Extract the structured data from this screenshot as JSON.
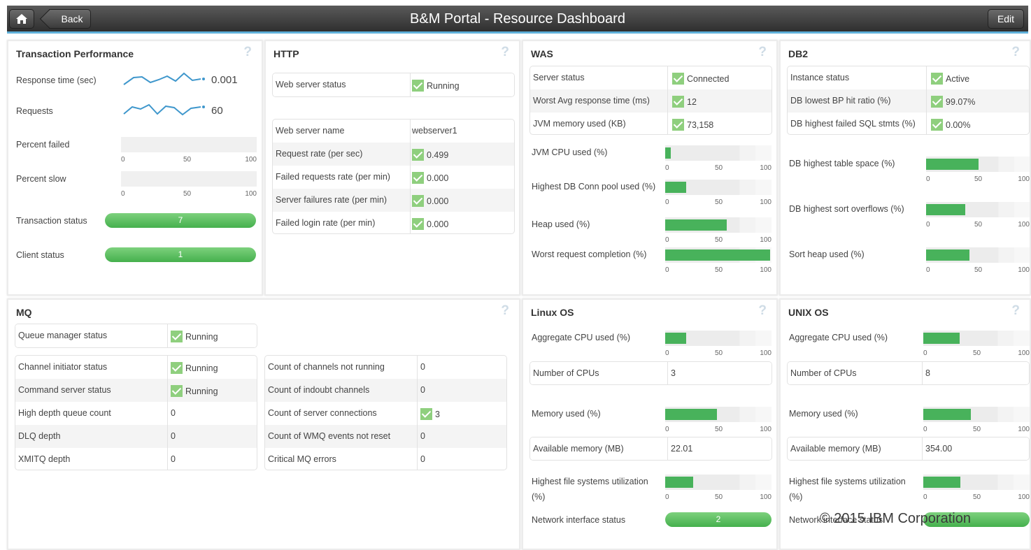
{
  "header": {
    "title": "B&M Portal - Resource Dashboard",
    "back_label": "Back",
    "edit_label": "Edit"
  },
  "transaction": {
    "title": "Transaction Performance",
    "response_label": "Response time (sec)",
    "response_value": "0.001",
    "requests_label": "Requests",
    "requests_value": "60",
    "pct_failed_label": "Percent failed",
    "pct_failed_value": 0,
    "pct_slow_label": "Percent slow",
    "pct_slow_value": 0,
    "tx_status_label": "Transaction status",
    "tx_status_value": "7",
    "client_status_label": "Client status",
    "client_status_value": "1"
  },
  "http": {
    "title": "HTTP",
    "ws_status_label": "Web server status",
    "ws_status_value": "Running",
    "rows": [
      {
        "label": "Web server name",
        "value": "webserver1",
        "check": false
      },
      {
        "label": "Request rate (per sec)",
        "value": "0.499",
        "check": true
      },
      {
        "label": "Failed requests rate (per min)",
        "value": "0.000",
        "check": true
      },
      {
        "label": "Server failures rate (per min)",
        "value": "0.000",
        "check": true
      },
      {
        "label": "Failed login rate (per min)",
        "value": "0.000",
        "check": true
      }
    ]
  },
  "was": {
    "title": "WAS",
    "rows": [
      {
        "label": "Server status",
        "value": "Connected"
      },
      {
        "label": "Worst Avg response time (ms)",
        "value": "12"
      },
      {
        "label": "JVM memory used (KB)",
        "value": "73,158"
      }
    ],
    "bars": [
      {
        "label": "JVM CPU used (%)",
        "value": 5
      },
      {
        "label": "Highest DB Conn pool used (%)",
        "value": 20
      },
      {
        "label": "Heap used (%)",
        "value": 58
      },
      {
        "label": "Worst request completion (%)",
        "value": 99
      }
    ]
  },
  "db2": {
    "title": "DB2",
    "rows": [
      {
        "label": "Instance status",
        "value": "Active"
      },
      {
        "label": "DB lowest BP hit ratio (%)",
        "value": "99.07%"
      },
      {
        "label": "DB highest failed SQL stmts (%)",
        "value": "0.00%"
      }
    ],
    "bars": [
      {
        "label": "DB highest table space (%)",
        "value": 51
      },
      {
        "label": "DB highest sort overflows (%)",
        "value": 38
      },
      {
        "label": "Sort heap used (%)",
        "value": 42
      }
    ]
  },
  "mq": {
    "title": "MQ",
    "qm_label": "Queue manager status",
    "qm_value": "Running",
    "left_rows": [
      {
        "label": "Channel initiator status",
        "value": "Running",
        "check": true
      },
      {
        "label": "Command server status",
        "value": "Running",
        "check": true
      },
      {
        "label": "High depth queue count",
        "value": "0",
        "check": false
      },
      {
        "label": "DLQ depth",
        "value": "0",
        "check": false
      },
      {
        "label": "XMITQ depth",
        "value": "0",
        "check": false
      }
    ],
    "right_rows": [
      {
        "label": "Count of channels not running",
        "value": "0",
        "check": false
      },
      {
        "label": "Count of indoubt channels",
        "value": "0",
        "check": false
      },
      {
        "label": "Count of server connections",
        "value": "3",
        "check": true
      },
      {
        "label": "Count of WMQ events not reset",
        "value": "0",
        "check": false
      },
      {
        "label": "Critical MQ errors",
        "value": "0",
        "check": false
      }
    ]
  },
  "linux": {
    "title": "Linux OS",
    "cpu_label": "Aggregate CPU used (%)",
    "cpu_value": 20,
    "ncpu_label": "Number of CPUs",
    "ncpu_value": "3",
    "mem_label": "Memory used (%)",
    "mem_value": 49,
    "avail_label": "Available memory (MB)",
    "avail_value": "22.01",
    "fs_label": "Highest file systems utilization",
    "fs_label2": "(%)",
    "fs_value": 26,
    "net_label": "Network interface status",
    "net_value": "2"
  },
  "unix": {
    "title": "UNIX OS",
    "cpu_label": "Aggregate CPU used (%)",
    "cpu_value": 34,
    "ncpu_label": "Number of CPUs",
    "ncpu_value": "8",
    "mem_label": "Memory used (%)",
    "mem_value": 45,
    "avail_label": "Available memory (MB)",
    "avail_value": "354.00",
    "fs_label": "Highest file systems utilization",
    "fs_label2": "(%)",
    "fs_value": 35,
    "net_label": "Network interface status",
    "net_value": ""
  },
  "ticks": {
    "t0": "0",
    "t50": "50",
    "t100": "100"
  },
  "help_mark": "?",
  "watermark": "© 2015 IBM Corporation",
  "colors": {
    "accent": "#5fb0d9",
    "bar": "#48b25b",
    "sparkline": "#3f97cc",
    "check": "#8fcf7e"
  }
}
